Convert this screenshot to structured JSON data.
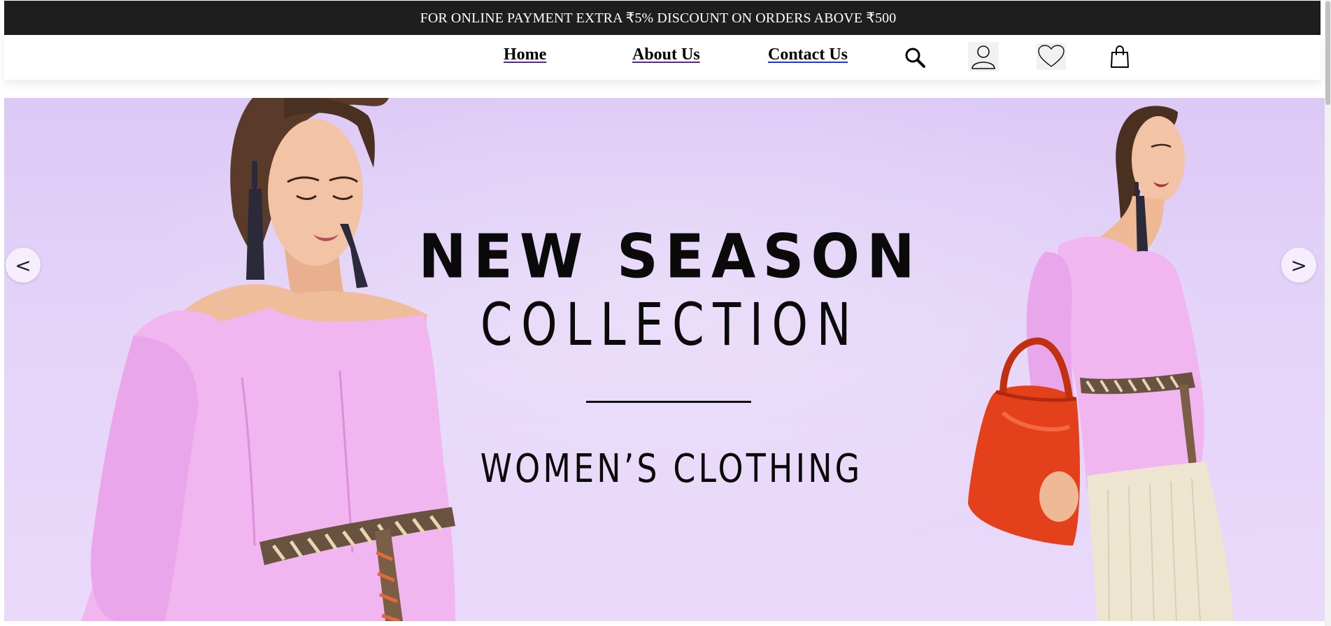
{
  "promo": {
    "text": "FOR ONLINE PAYMENT EXTRA ₹5% DISCOUNT ON ORDERS ABOVE ₹500"
  },
  "nav": {
    "links": [
      {
        "label": "Home"
      },
      {
        "label": "About Us"
      },
      {
        "label": "Contact Us"
      }
    ],
    "icons": [
      "search-icon",
      "user-icon",
      "heart-icon",
      "shopping-bag-icon"
    ]
  },
  "hero": {
    "heading_line1": "NEW SEASON",
    "heading_line2": "COLLECTION",
    "subheading": "WOMEN’S CLOTHING",
    "prev_label": "<",
    "next_label": ">"
  },
  "colors": {
    "promo_background": "#1e1e1e",
    "hero_background": "#e4d4f8",
    "blouse": "#f1b5f0",
    "bag": "#e5401c",
    "skirt": "#ede5cf"
  }
}
